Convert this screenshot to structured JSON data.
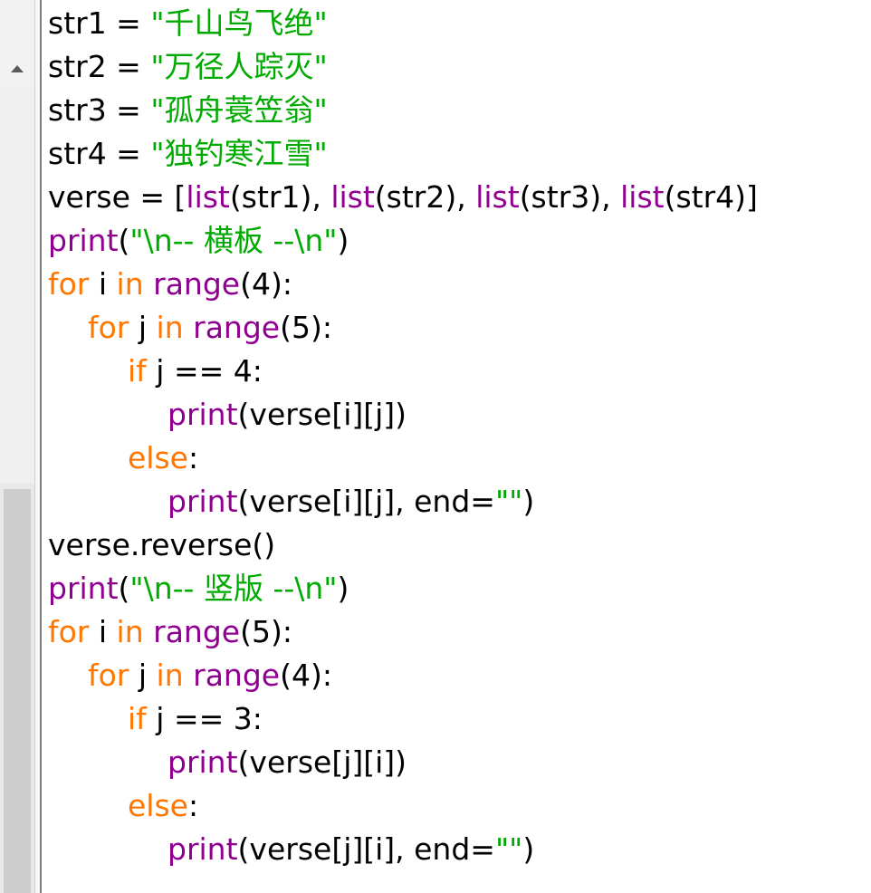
{
  "lines": [
    {
      "indent": 0,
      "tokens": [
        {
          "t": "str1 = ",
          "c": "plain"
        },
        {
          "t": "\"千山鸟飞绝\"",
          "c": "string"
        }
      ]
    },
    {
      "indent": 0,
      "tokens": [
        {
          "t": "str2 = ",
          "c": "plain"
        },
        {
          "t": "\"万径人踪灭\"",
          "c": "string"
        }
      ]
    },
    {
      "indent": 0,
      "tokens": [
        {
          "t": "str3 = ",
          "c": "plain"
        },
        {
          "t": "\"孤舟蓑笠翁\"",
          "c": "string"
        }
      ]
    },
    {
      "indent": 0,
      "tokens": [
        {
          "t": "str4 = ",
          "c": "plain"
        },
        {
          "t": "\"独钓寒江雪\"",
          "c": "string"
        }
      ]
    },
    {
      "indent": 0,
      "tokens": [
        {
          "t": "verse = [",
          "c": "plain"
        },
        {
          "t": "list",
          "c": "builtin"
        },
        {
          "t": "(str1), ",
          "c": "plain"
        },
        {
          "t": "list",
          "c": "builtin"
        },
        {
          "t": "(str2), ",
          "c": "plain"
        },
        {
          "t": "list",
          "c": "builtin"
        },
        {
          "t": "(str3), ",
          "c": "plain"
        },
        {
          "t": "list",
          "c": "builtin"
        },
        {
          "t": "(str4)]",
          "c": "plain"
        }
      ]
    },
    {
      "indent": 0,
      "tokens": [
        {
          "t": "print",
          "c": "builtin"
        },
        {
          "t": "(",
          "c": "plain"
        },
        {
          "t": "\"\\n-- 横板 --\\n\"",
          "c": "string"
        },
        {
          "t": ")",
          "c": "plain"
        }
      ]
    },
    {
      "indent": 0,
      "tokens": [
        {
          "t": "for",
          "c": "keyword"
        },
        {
          "t": " i ",
          "c": "plain"
        },
        {
          "t": "in",
          "c": "keyword"
        },
        {
          "t": " ",
          "c": "plain"
        },
        {
          "t": "range",
          "c": "builtin"
        },
        {
          "t": "(4):",
          "c": "plain"
        }
      ]
    },
    {
      "indent": 1,
      "tokens": [
        {
          "t": "for",
          "c": "keyword"
        },
        {
          "t": " j ",
          "c": "plain"
        },
        {
          "t": "in",
          "c": "keyword"
        },
        {
          "t": " ",
          "c": "plain"
        },
        {
          "t": "range",
          "c": "builtin"
        },
        {
          "t": "(5):",
          "c": "plain"
        }
      ]
    },
    {
      "indent": 2,
      "tokens": [
        {
          "t": "if",
          "c": "keyword"
        },
        {
          "t": " j == 4:",
          "c": "plain"
        }
      ]
    },
    {
      "indent": 3,
      "tokens": [
        {
          "t": "print",
          "c": "builtin"
        },
        {
          "t": "(verse[i][j])",
          "c": "plain"
        }
      ]
    },
    {
      "indent": 2,
      "tokens": [
        {
          "t": "else",
          "c": "keyword"
        },
        {
          "t": ":",
          "c": "plain"
        }
      ]
    },
    {
      "indent": 3,
      "tokens": [
        {
          "t": "print",
          "c": "builtin"
        },
        {
          "t": "(verse[i][j], end=",
          "c": "plain"
        },
        {
          "t": "\"\"",
          "c": "string"
        },
        {
          "t": ")",
          "c": "plain"
        }
      ]
    },
    {
      "indent": 0,
      "tokens": [
        {
          "t": "verse.reverse()",
          "c": "plain"
        }
      ]
    },
    {
      "indent": 0,
      "tokens": [
        {
          "t": "print",
          "c": "builtin"
        },
        {
          "t": "(",
          "c": "plain"
        },
        {
          "t": "\"\\n-- 竖版 --\\n\"",
          "c": "string"
        },
        {
          "t": ")",
          "c": "plain"
        }
      ]
    },
    {
      "indent": 0,
      "tokens": [
        {
          "t": "for",
          "c": "keyword"
        },
        {
          "t": " i ",
          "c": "plain"
        },
        {
          "t": "in",
          "c": "keyword"
        },
        {
          "t": " ",
          "c": "plain"
        },
        {
          "t": "range",
          "c": "builtin"
        },
        {
          "t": "(5):",
          "c": "plain"
        }
      ]
    },
    {
      "indent": 1,
      "tokens": [
        {
          "t": "for",
          "c": "keyword"
        },
        {
          "t": " j ",
          "c": "plain"
        },
        {
          "t": "in",
          "c": "keyword"
        },
        {
          "t": " ",
          "c": "plain"
        },
        {
          "t": "range",
          "c": "builtin"
        },
        {
          "t": "(4):",
          "c": "plain"
        }
      ]
    },
    {
      "indent": 2,
      "tokens": [
        {
          "t": "if",
          "c": "keyword"
        },
        {
          "t": " j == 3:",
          "c": "plain"
        }
      ]
    },
    {
      "indent": 3,
      "tokens": [
        {
          "t": "print",
          "c": "builtin"
        },
        {
          "t": "(verse[j][i])",
          "c": "plain"
        }
      ]
    },
    {
      "indent": 2,
      "tokens": [
        {
          "t": "else",
          "c": "keyword"
        },
        {
          "t": ":",
          "c": "plain"
        }
      ]
    },
    {
      "indent": 3,
      "tokens": [
        {
          "t": "print",
          "c": "builtin"
        },
        {
          "t": "(verse[j][i], end=",
          "c": "plain"
        },
        {
          "t": "\"\"",
          "c": "string"
        },
        {
          "t": ")",
          "c": "plain"
        }
      ]
    }
  ],
  "colors": {
    "plain": "#000000",
    "keyword": "#ff7700",
    "builtin": "#900090",
    "string": "#00aa00"
  },
  "icons": {
    "scroll_up": "triangle-up-icon"
  }
}
